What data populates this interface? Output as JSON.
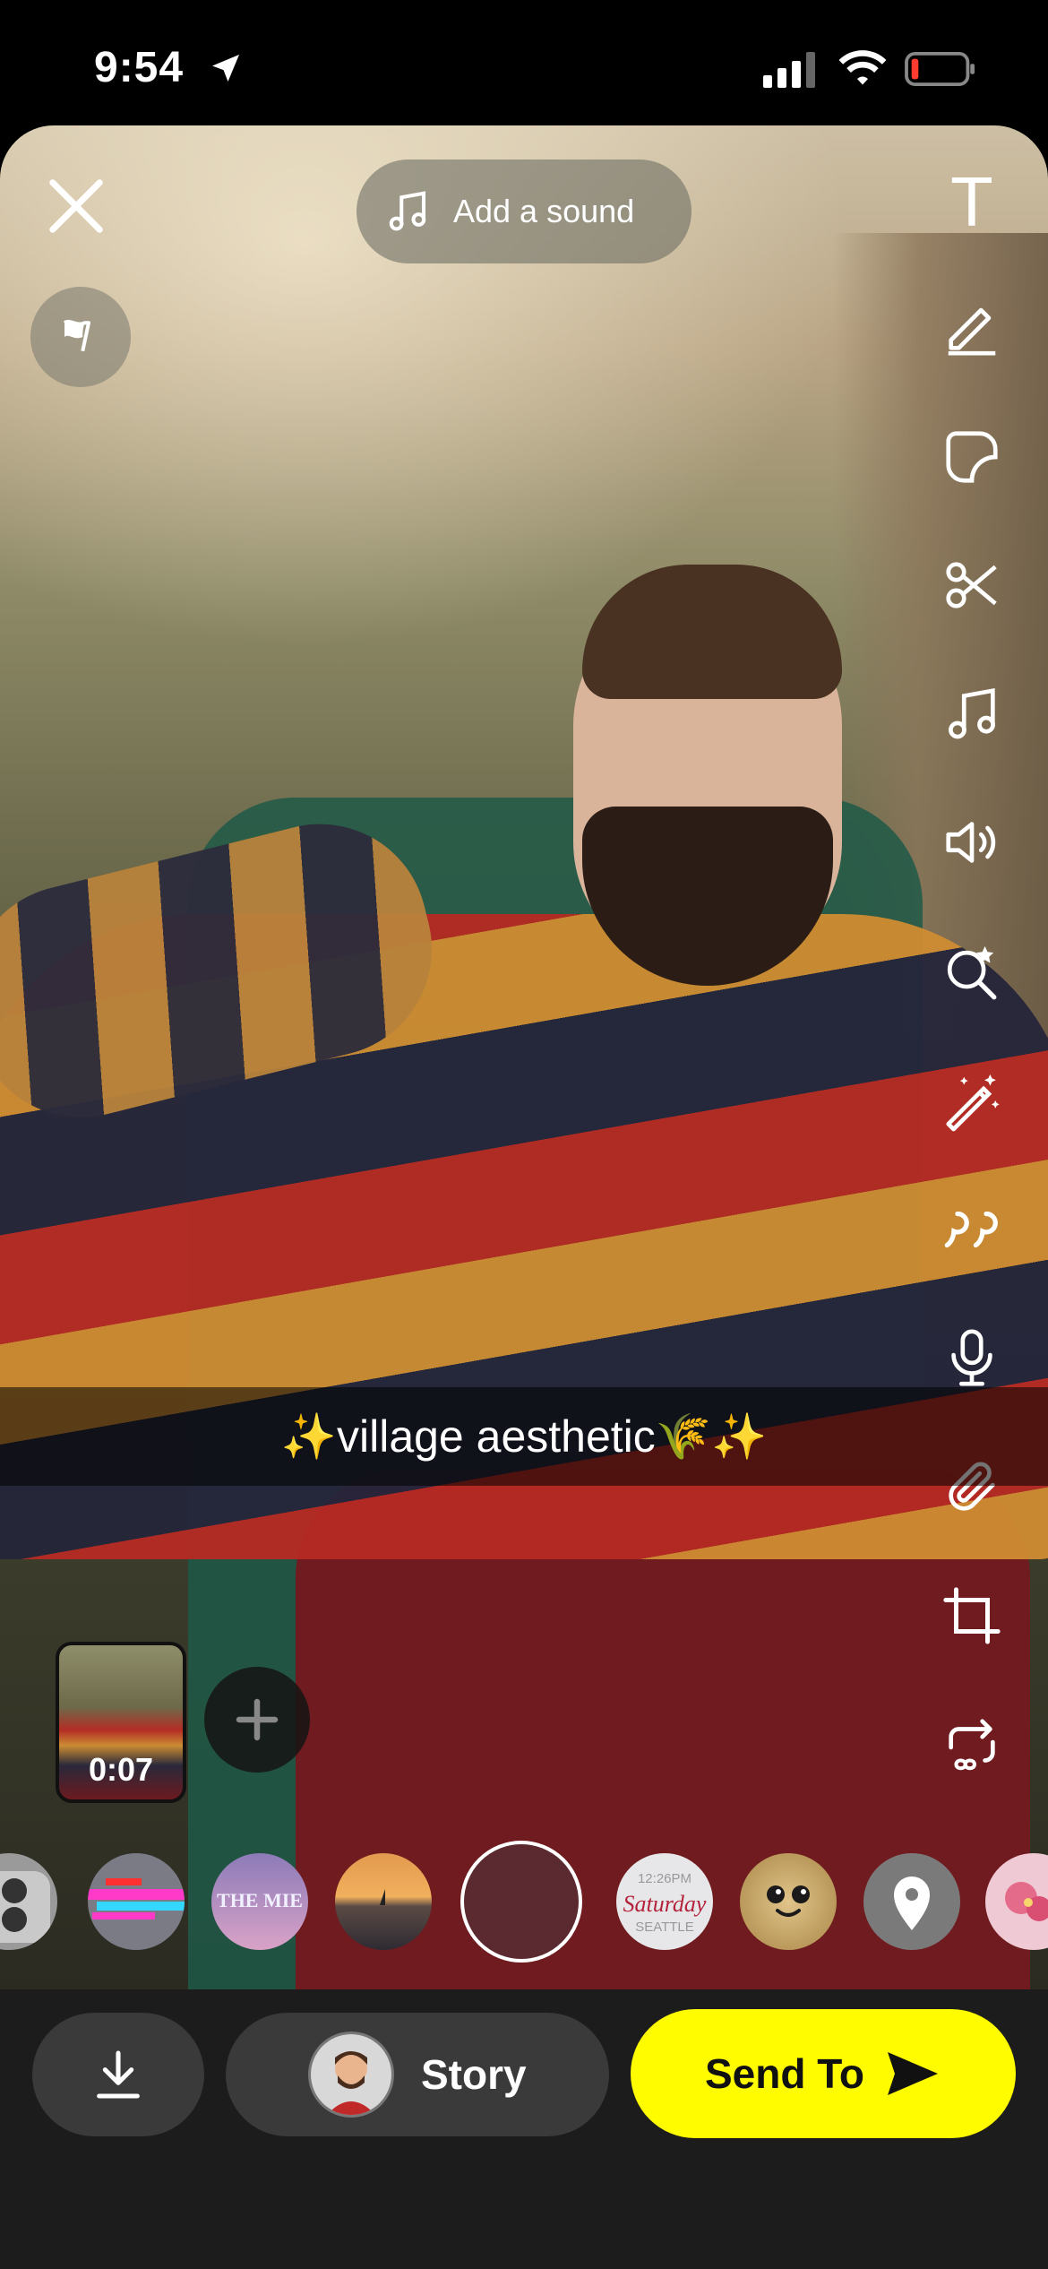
{
  "status_bar": {
    "time": "9:54",
    "icons": [
      "location-arrow-icon",
      "signal-icon",
      "wifi-icon",
      "battery-low-icon"
    ]
  },
  "top_bar": {
    "close_icon": "close-icon",
    "flag_icon": "flag-icon",
    "add_sound_label": "Add a sound"
  },
  "tools": [
    {
      "name": "text-tool",
      "label": "T"
    },
    {
      "name": "pencil-icon"
    },
    {
      "name": "sticker-icon"
    },
    {
      "name": "scissors-icon"
    },
    {
      "name": "music-note-icon"
    },
    {
      "name": "speaker-icon"
    },
    {
      "name": "lens-search-icon"
    },
    {
      "name": "magic-wand-icon"
    },
    {
      "name": "quote-icon"
    },
    {
      "name": "microphone-icon"
    },
    {
      "name": "paperclip-icon"
    },
    {
      "name": "crop-icon"
    },
    {
      "name": "loop-icon"
    }
  ],
  "caption": {
    "text": "✨village aesthetic🌾✨"
  },
  "clip": {
    "duration": "0:07"
  },
  "lenses": {
    "items": [
      {
        "name": "lens-camera"
      },
      {
        "name": "lens-glitch"
      },
      {
        "name": "lens-city",
        "text": "THE MIE"
      },
      {
        "name": "lens-sunset"
      },
      {
        "name": "lens-selected"
      },
      {
        "name": "lens-time",
        "time": "12:26PM",
        "day": "Saturday",
        "place": "SEATTLE"
      },
      {
        "name": "lens-glitter-face"
      },
      {
        "name": "lens-location"
      },
      {
        "name": "lens-flowers"
      }
    ]
  },
  "bottom_bar": {
    "story_label": "Story",
    "send_label": "Send To"
  },
  "colors": {
    "send_button": "#fffc00",
    "bottom_bar": "#1c1c1c",
    "pill": "#3a3a3a"
  }
}
